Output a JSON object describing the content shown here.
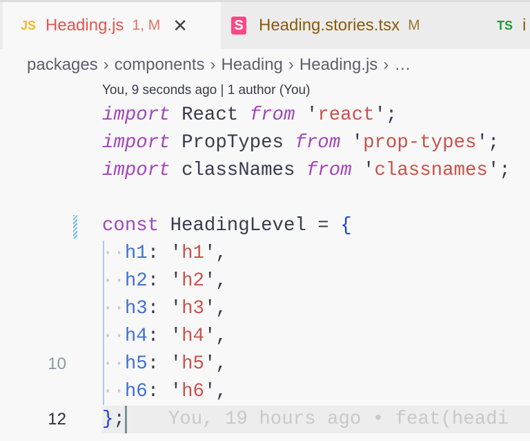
{
  "tabs": [
    {
      "icon": "JS",
      "icon_color": "#f0b929",
      "label": "Heading.js",
      "badge": "1, M",
      "color": "#e2554f",
      "active": true
    },
    {
      "icon": "S",
      "icon_color": "#ff4785",
      "label": "Heading.stories.tsx",
      "badge": "M",
      "color": "#8a5a0b"
    },
    {
      "icon": "TS",
      "icon_color": "#1e9c3c",
      "label": "i",
      "color": "#8a5a0b"
    }
  ],
  "breadcrumb": [
    "packages",
    "components",
    "Heading",
    "Heading.js",
    "…"
  ],
  "blame_header": "You, 9 seconds ago | 1 author (You)",
  "lines": [
    {
      "n": "",
      "tokens": [
        [
          "kw",
          "import"
        ],
        [
          "p",
          " "
        ],
        [
          "id",
          "React"
        ],
        [
          "p",
          " "
        ],
        [
          "kw",
          "from"
        ],
        [
          "p",
          " '"
        ],
        [
          "str",
          "react"
        ],
        [
          "p",
          "';"
        ]
      ]
    },
    {
      "n": "",
      "tokens": [
        [
          "kw",
          "import"
        ],
        [
          "p",
          " "
        ],
        [
          "id",
          "PropTypes"
        ],
        [
          "p",
          " "
        ],
        [
          "kw",
          "from"
        ],
        [
          "p",
          " '"
        ],
        [
          "str",
          "prop-types"
        ],
        [
          "p",
          "';"
        ]
      ]
    },
    {
      "n": "",
      "tokens": [
        [
          "kw",
          "import"
        ],
        [
          "p",
          " "
        ],
        [
          "id",
          "classNames"
        ],
        [
          "p",
          " "
        ],
        [
          "kw",
          "from"
        ],
        [
          "p",
          " '"
        ],
        [
          "str",
          "classnames"
        ],
        [
          "p",
          "';"
        ]
      ]
    },
    {
      "n": "",
      "tokens": []
    },
    {
      "n": "",
      "tokens": [
        [
          "kw2",
          "const"
        ],
        [
          "p",
          " "
        ],
        [
          "id",
          "HeadingLevel"
        ],
        [
          "p",
          " = "
        ],
        [
          "brace",
          "{"
        ]
      ]
    },
    {
      "n": "",
      "tokens": [
        [
          "ws",
          "··"
        ],
        [
          "prop",
          "h1"
        ],
        [
          "p",
          ": '"
        ],
        [
          "str",
          "h1"
        ],
        [
          "p",
          "',"
        ]
      ]
    },
    {
      "n": "",
      "tokens": [
        [
          "ws",
          "··"
        ],
        [
          "prop",
          "h2"
        ],
        [
          "p",
          ": '"
        ],
        [
          "str",
          "h2"
        ],
        [
          "p",
          "',"
        ]
      ]
    },
    {
      "n": "",
      "tokens": [
        [
          "ws",
          "··"
        ],
        [
          "prop",
          "h3"
        ],
        [
          "p",
          ": '"
        ],
        [
          "str",
          "h3"
        ],
        [
          "p",
          "',"
        ]
      ]
    },
    {
      "n": "",
      "tokens": [
        [
          "ws",
          "··"
        ],
        [
          "prop",
          "h4"
        ],
        [
          "p",
          ": '"
        ],
        [
          "str",
          "h4"
        ],
        [
          "p",
          "',"
        ]
      ]
    },
    {
      "n": "10",
      "tokens": [
        [
          "ws",
          "··"
        ],
        [
          "prop",
          "h5"
        ],
        [
          "p",
          ": '"
        ],
        [
          "str",
          "h5"
        ],
        [
          "p",
          "',"
        ]
      ]
    },
    {
      "n": "",
      "tokens": [
        [
          "ws",
          "··"
        ],
        [
          "prop",
          "h6"
        ],
        [
          "p",
          ": '"
        ],
        [
          "str",
          "h6"
        ],
        [
          "p",
          "',"
        ]
      ]
    },
    {
      "n": "12",
      "current": true,
      "tokens": [
        [
          "brace",
          "}"
        ],
        [
          "p",
          ";"
        ]
      ],
      "ghost": "You, 19 hours ago • feat(headi"
    }
  ]
}
